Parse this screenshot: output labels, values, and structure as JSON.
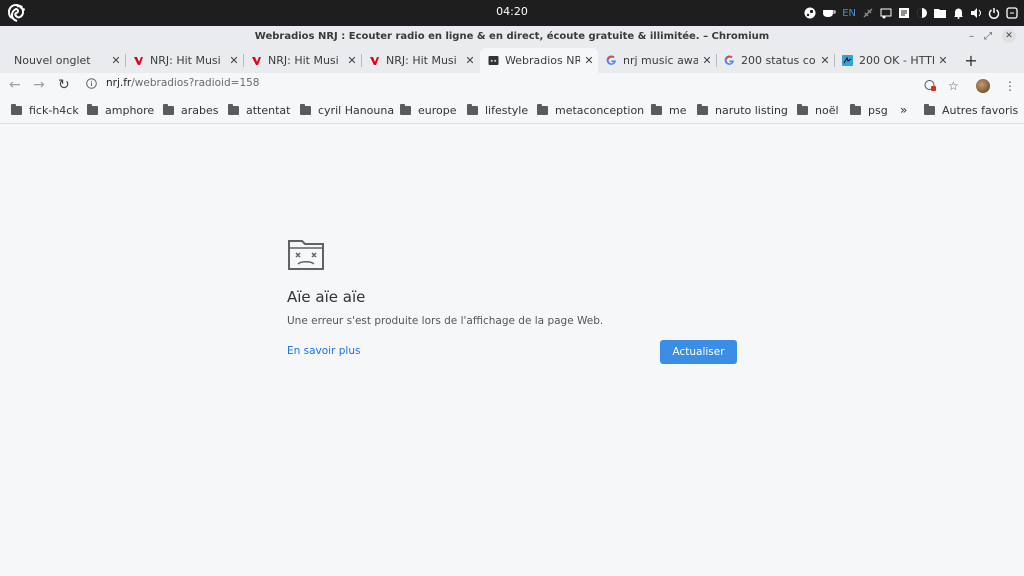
{
  "system": {
    "clock": "04:20",
    "lang": "EN"
  },
  "window": {
    "title": "Webradios NRJ : Ecouter radio en ligne & en direct, écoute gratuite & illimitée. – Chromium"
  },
  "tabs": [
    {
      "label": "Nouvel onglet",
      "icon": "none"
    },
    {
      "label": "NRJ: Hit Musi",
      "icon": "nrj-icon"
    },
    {
      "label": "NRJ: Hit Musi",
      "icon": "nrj-icon"
    },
    {
      "label": "NRJ: Hit Musi",
      "icon": "nrj-icon"
    },
    {
      "label": "Webradios NR",
      "icon": "sad-page-icon"
    },
    {
      "label": "nrj music awa",
      "icon": "google-icon"
    },
    {
      "label": "200 status co",
      "icon": "google-icon"
    },
    {
      "label": "200 OK - HTTP",
      "icon": "mdn-icon"
    }
  ],
  "address": {
    "domain": "nrj.fr",
    "path": "/webradios?radioid=158"
  },
  "bookmarks": [
    "fick-h4ck",
    "amphore",
    "arabes",
    "attentat",
    "cyril Hanouna",
    "europe",
    "lifestyle",
    "metaconception",
    "me",
    "naruto listing",
    "noël",
    "psg"
  ],
  "bookmarks_overflow": "»",
  "other_bookmarks": "Autres favoris",
  "error": {
    "title": "Aïe aïe aïe",
    "message": "Une erreur s'est produite lors de l'affichage de la page Web.",
    "learn_more": "En savoir plus",
    "reload": "Actualiser"
  },
  "colors": {
    "accent": "#3a8ee6",
    "link": "#1a73e8"
  }
}
